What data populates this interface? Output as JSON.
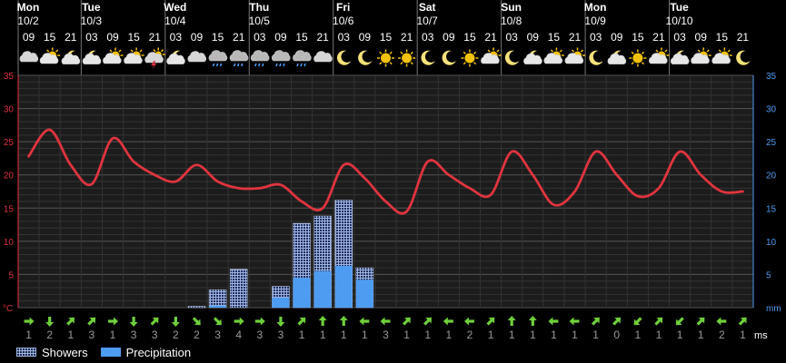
{
  "days": [
    {
      "name": "Mon",
      "date": "10/2"
    },
    {
      "name": "Tue",
      "date": "10/3"
    },
    {
      "name": "Wed",
      "date": "10/4"
    },
    {
      "name": "Thu",
      "date": "10/5"
    },
    {
      "name": "Fri",
      "date": "10/6"
    },
    {
      "name": "Sat",
      "date": "10/7"
    },
    {
      "name": "Sun",
      "date": "10/8"
    },
    {
      "name": "Mon",
      "date": "10/9"
    },
    {
      "name": "Tue",
      "date": "10/10"
    }
  ],
  "hours": [
    "09",
    "15",
    "21",
    "03",
    "09",
    "15",
    "21",
    "03",
    "09",
    "15",
    "21",
    "03",
    "09",
    "15",
    "21",
    "03",
    "09",
    "15",
    "21",
    "03",
    "09",
    "15",
    "21",
    "03",
    "09",
    "15",
    "21",
    "03",
    "09",
    "15",
    "21",
    "03",
    "09",
    "15",
    "21"
  ],
  "icons": [
    "cloudy-icon",
    "sun-cloud-icon",
    "moon-cloud-icon",
    "moon-cloud-icon",
    "sun-cloud-icon",
    "sun-cloud-icon",
    "thunder-cloud-icon",
    "moon-cloud-icon",
    "cloudy-icon",
    "rain-cloud-icon",
    "rain-cloud-icon",
    "rain-cloud-icon",
    "rain-cloud-icon",
    "rain-cloud-icon",
    "cloudy-icon",
    "moon-icon",
    "moon-icon",
    "sun-icon",
    "sun-icon",
    "moon-icon",
    "moon-icon",
    "sun-icon",
    "sun-cloud-icon",
    "moon-icon",
    "moon-cloud-icon",
    "sun-cloud-icon",
    "sun-cloud-icon",
    "moon-icon",
    "moon-cloud-icon",
    "sun-icon",
    "sun-cloud-icon",
    "moon-cloud-icon",
    "sun-cloud-icon",
    "sun-cloud-icon",
    "moon-icon"
  ],
  "colors": {
    "temp": "#e0343e",
    "precip": "#4d9cf2",
    "showers": "#1a2a55",
    "wind": "#6fcf3a",
    "left_axis": "#e0343e",
    "right_axis": "#4d9cf2"
  },
  "chart_data": {
    "type": "line",
    "x": [
      "10/2 09",
      "10/2 15",
      "10/2 21",
      "10/3 03",
      "10/3 09",
      "10/3 15",
      "10/3 21",
      "10/4 03",
      "10/4 09",
      "10/4 15",
      "10/4 21",
      "10/5 03",
      "10/5 09",
      "10/5 15",
      "10/5 21",
      "10/6 03",
      "10/6 09",
      "10/6 15",
      "10/6 21",
      "10/7 03",
      "10/7 09",
      "10/7 15",
      "10/7 21",
      "10/8 03",
      "10/8 09",
      "10/8 15",
      "10/8 21",
      "10/9 03",
      "10/9 09",
      "10/9 15",
      "10/9 21",
      "10/10 03",
      "10/10 09",
      "10/10 15",
      "10/10 21"
    ],
    "temperature": [
      22.8,
      26.8,
      21.5,
      18.6,
      25.5,
      22.0,
      20.0,
      19.0,
      21.5,
      19.0,
      18.0,
      18.0,
      18.5,
      16.0,
      15.0,
      21.5,
      19.5,
      16.0,
      14.5,
      22.0,
      20.0,
      18.0,
      17.0,
      23.5,
      20.0,
      15.5,
      17.5,
      23.5,
      20.0,
      16.8,
      18.0,
      23.5,
      20.0,
      17.5,
      17.5
    ],
    "series": [
      {
        "name": "Showers",
        "values": [
          0,
          0,
          0,
          0,
          0,
          0,
          0,
          0,
          0.2,
          2.7,
          5.8,
          0,
          3.2,
          12.7,
          13.8,
          16.2,
          6.0,
          0,
          0,
          0,
          0,
          0,
          0,
          0,
          0,
          0,
          0,
          0,
          0,
          0,
          0,
          0,
          0,
          0,
          0
        ]
      },
      {
        "name": "Precipitation",
        "values": [
          0,
          0,
          0,
          0,
          0,
          0,
          0,
          0,
          0,
          0.3,
          0,
          0,
          1.5,
          4.5,
          5.5,
          6.3,
          4.2,
          0,
          0,
          0,
          0,
          0,
          0,
          0,
          0,
          0,
          0,
          0,
          0,
          0,
          0,
          0,
          0,
          0,
          0
        ]
      }
    ],
    "ylim": [
      0,
      35
    ],
    "ylabel_left": "°C",
    "ylabel_right": "mm",
    "yticks": [
      0,
      5,
      10,
      15,
      20,
      25,
      30,
      35
    ],
    "grid": true,
    "legend_position": "bottom-left"
  },
  "wind": {
    "unit": "ms",
    "speeds": [
      1,
      2,
      1,
      3,
      1,
      3,
      3,
      2,
      2,
      3,
      4,
      3,
      3,
      1,
      1,
      1,
      1,
      3,
      1,
      1,
      1,
      2,
      1,
      1,
      1,
      1,
      1,
      1,
      0,
      1,
      1,
      1,
      1,
      2,
      1
    ],
    "dirs": [
      90,
      180,
      45,
      45,
      90,
      180,
      45,
      180,
      135,
      135,
      90,
      90,
      180,
      45,
      0,
      0,
      270,
      270,
      45,
      45,
      270,
      270,
      45,
      0,
      0,
      270,
      270,
      45,
      45,
      225,
      45,
      225,
      45,
      270,
      45
    ]
  },
  "legend": [
    {
      "label": "Showers"
    },
    {
      "label": "Precipitation"
    }
  ]
}
